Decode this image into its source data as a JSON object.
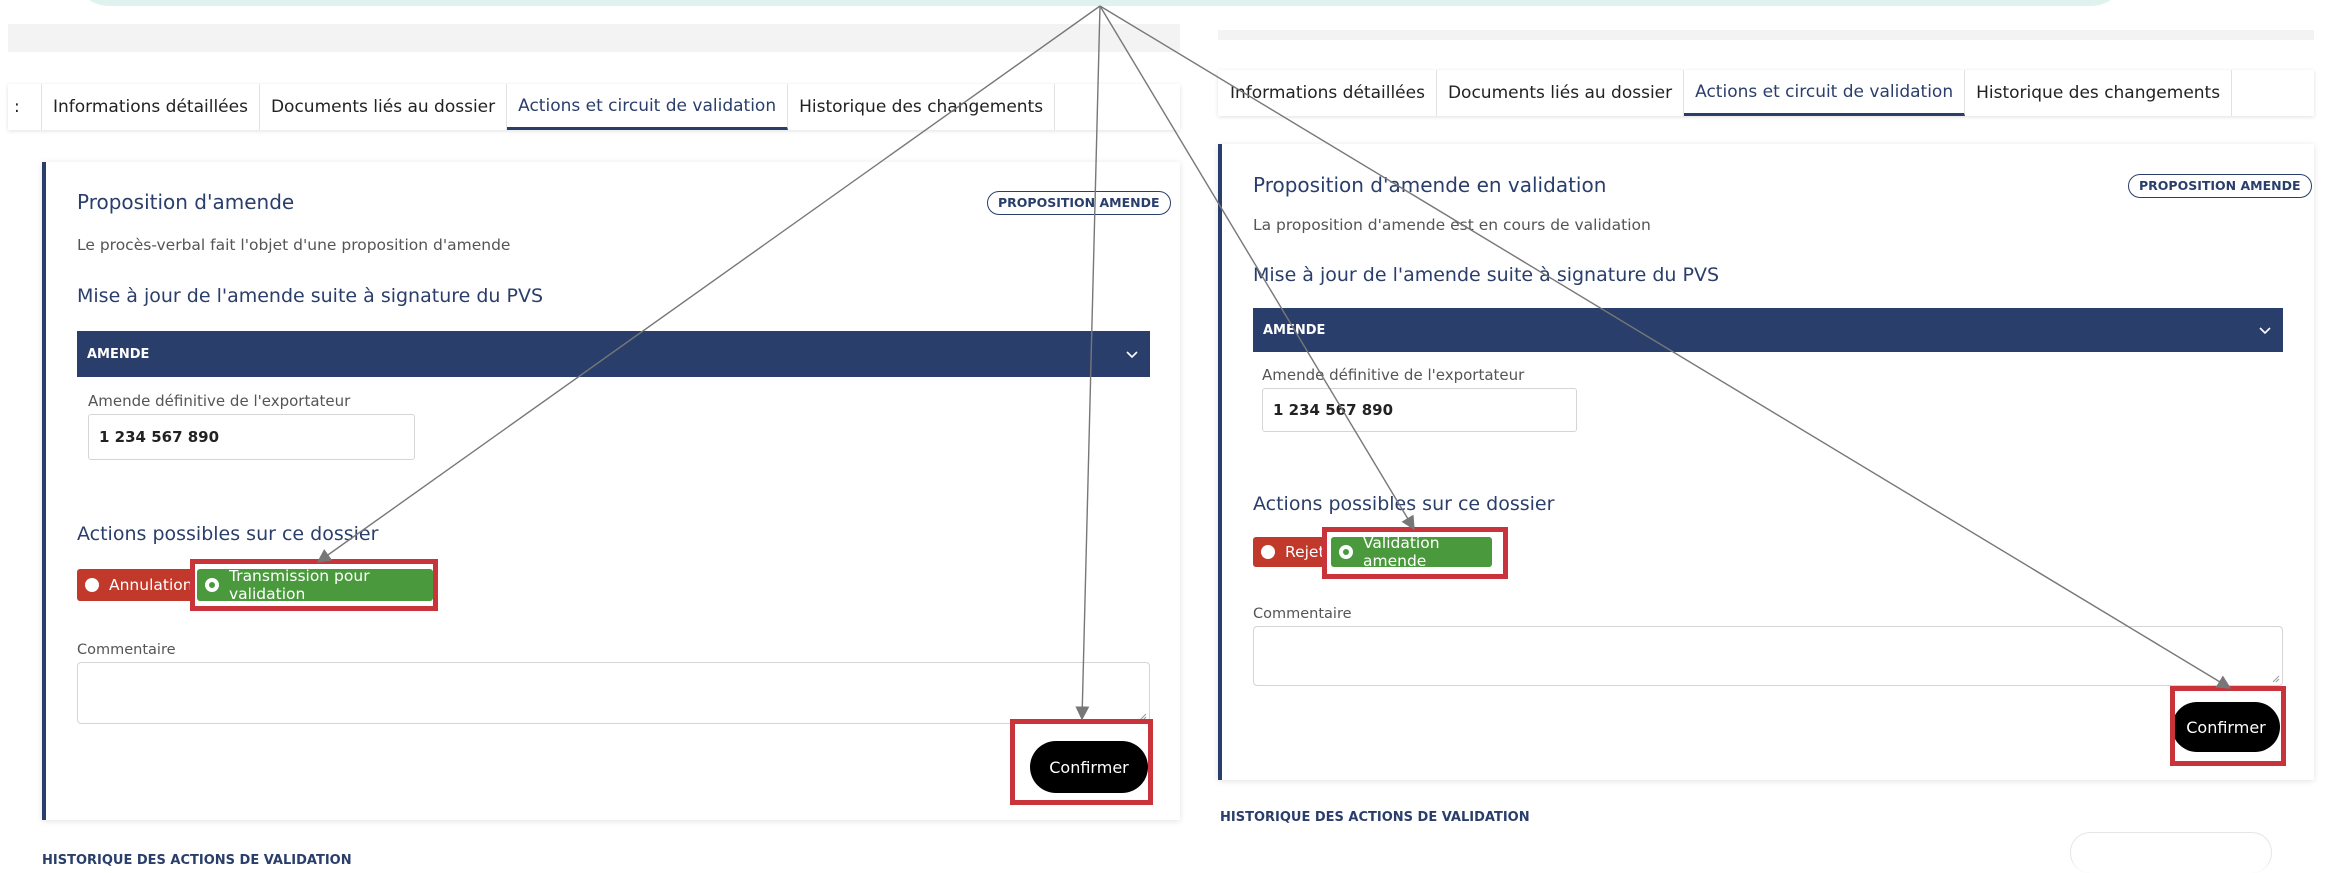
{
  "tabs": {
    "first_fragment": ":",
    "items": [
      {
        "label": "Informations détaillées"
      },
      {
        "label": "Documents liés au dossier"
      },
      {
        "label": "Actions et circuit de validation"
      },
      {
        "label": "Historique des changements"
      }
    ]
  },
  "left": {
    "title": "Proposition d'amende",
    "badge": "PROPOSITION AMENDE",
    "description": "Le procès-verbal fait l'objet d'une proposition d'amende",
    "subtitle": "Mise à jour de l'amende suite à signature du PVS",
    "accordion": "AMENDE",
    "field_label": "Amende définitive de l'exportateur",
    "field_value": "1 234 567 890",
    "actions_title": "Actions possibles sur ce dossier",
    "action_reject": "Annulation",
    "action_accept": "Transmission pour validation",
    "comment_label": "Commentaire",
    "confirm": "Confirmer",
    "history": "HISTORIQUE DES ACTIONS DE VALIDATION"
  },
  "right": {
    "title": "Proposition d'amende en validation",
    "badge": "PROPOSITION AMENDE",
    "description": "La proposition d'amende est en cours de validation",
    "subtitle": "Mise à jour de l'amende suite à signature du PVS",
    "accordion": "AMENDE",
    "field_label": "Amende définitive de l'exportateur",
    "field_value": "1 234 567 890",
    "actions_title": "Actions possibles sur ce dossier",
    "action_reject": "Rejet",
    "action_accept": "Validation amende",
    "comment_label": "Commentaire",
    "confirm": "Confirmer",
    "history": "HISTORIQUE DES ACTIONS DE VALIDATION"
  },
  "colors": {
    "navy": "#2a3e6b",
    "reject_red": "#c0392b",
    "accept_green": "#4a9a3d",
    "highlight_red": "#c8343a"
  }
}
